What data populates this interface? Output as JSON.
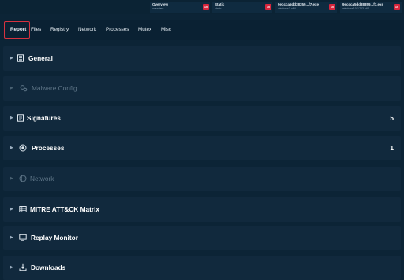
{
  "top_tabs": [
    {
      "title": "Overview",
      "subtitle": "overview",
      "score": "10"
    },
    {
      "title": "Static",
      "subtitle": "static",
      "score": "10"
    },
    {
      "title": "9eccca5dd38359...f7.exe",
      "subtitle": "windows7-x64",
      "score": "10"
    },
    {
      "title": "9eccca5dd38359...f7.exe",
      "subtitle": "windows10-1703-x64",
      "score": "10"
    }
  ],
  "nav": [
    "Report",
    "Files",
    "Registry",
    "Network",
    "Processes",
    "Mutex",
    "Misc"
  ],
  "sections": [
    {
      "label": "General",
      "count": "",
      "icon": "document-icon",
      "enabled": true
    },
    {
      "label": "Malware Config",
      "count": "",
      "icon": "config-icon",
      "enabled": false
    },
    {
      "label": "Signatures",
      "count": "5",
      "icon": "signatures-icon",
      "enabled": true
    },
    {
      "label": "Processes",
      "count": "1",
      "icon": "processes-icon",
      "enabled": true
    },
    {
      "label": "Network",
      "count": "",
      "icon": "globe-icon",
      "enabled": false
    },
    {
      "label": "MITRE ATT&CK Matrix",
      "count": "",
      "icon": "matrix-icon",
      "enabled": true
    },
    {
      "label": "Replay Monitor",
      "count": "",
      "icon": "monitor-icon",
      "enabled": true
    },
    {
      "label": "Downloads",
      "count": "",
      "icon": "download-icon",
      "enabled": true
    }
  ],
  "colors": {
    "background": "#0c2436",
    "section": "#11293d",
    "accent": "#d6323f",
    "score": "#d7263d"
  }
}
